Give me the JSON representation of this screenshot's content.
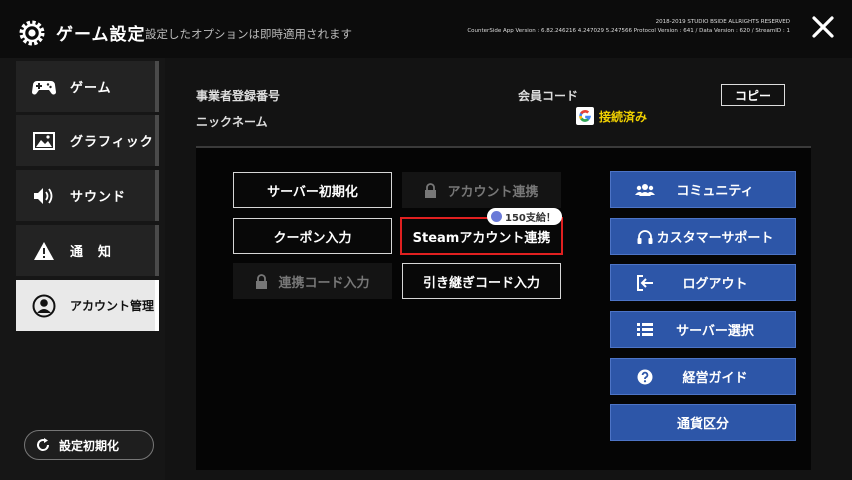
{
  "header": {
    "title": "ゲーム設定",
    "subtitle": "設定したオプションは即時適用されます",
    "copyright": "2018-2019 STUDIO BSIDE ALLRIGHTS RESERVED",
    "version": "CounterSide App Version : 6.82.246216 4.247029 5.247566 Protocol Version : 641 / Data Version : 620 / StreamID : 1"
  },
  "sidebar": {
    "items": [
      {
        "label": "ゲーム",
        "icon": "gamepad-icon",
        "active": false
      },
      {
        "label": "グラフィック",
        "icon": "image-icon",
        "active": false
      },
      {
        "label": "サウンド",
        "icon": "speaker-icon",
        "active": false
      },
      {
        "label": "通　知",
        "icon": "warning-icon",
        "active": false
      },
      {
        "label": "アカウント管理",
        "icon": "user-icon",
        "active": true
      }
    ],
    "reset_label": "設定初期化"
  },
  "account_info": {
    "business_reg_label": "事業者登録番号",
    "nickname_label": "ニックネーム",
    "member_code_label": "会員コード",
    "copy_label": "コピー",
    "linked_label": "接続済み"
  },
  "actions": {
    "server_reset": "サーバー初期化",
    "account_link": "アカウント連携",
    "coupon": "クーポン入力",
    "steam_link": "Steamアカウント連携",
    "steam_badge": "150支給！",
    "link_code": "連携コード入力",
    "transfer_code": "引き継ぎコード入力"
  },
  "side_buttons": {
    "community": "コミュニティ",
    "support": "カスタマーサポート",
    "logout": "ログアウト",
    "server_select": "サーバー選択",
    "guide": "経営ガイド",
    "currency": "通貨区分"
  },
  "colors": {
    "accent_blue": "#2d56a8",
    "linked_yellow": "#f0d000",
    "highlight_red": "#e02020"
  }
}
